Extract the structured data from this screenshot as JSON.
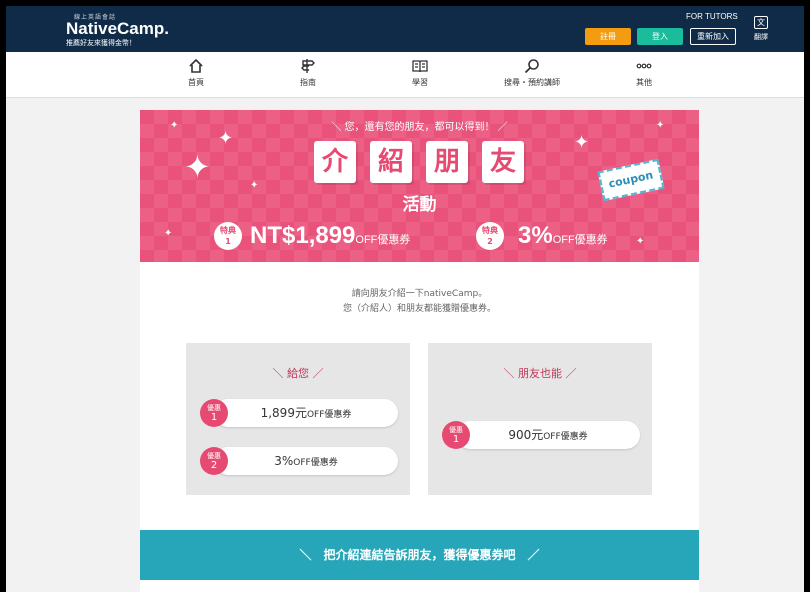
{
  "header": {
    "logo_small": "線上英語會話",
    "logo_brand": "NativeCamp.",
    "logo_tagline": "推薦好友來獲得金幣！",
    "for_tutors": "FOR TUTORS",
    "register_label": "註冊",
    "login_label": "登入",
    "rejoin_label": "重新加入",
    "translate_label": "翻譯"
  },
  "nav": {
    "items": [
      {
        "label": "首頁",
        "icon": "home-icon"
      },
      {
        "label": "指南",
        "icon": "signpost-icon"
      },
      {
        "label": "學習",
        "icon": "book-icon"
      },
      {
        "label": "搜尋・預約講師",
        "icon": "search-icon"
      },
      {
        "label": "其他",
        "icon": "more-icon"
      }
    ]
  },
  "hero": {
    "subtitle": "＼ 您，還有您的朋友，都可以得到！ ／",
    "title_chars": [
      "介",
      "紹",
      "朋",
      "友"
    ],
    "campaign": "活動",
    "perk1_badge": "特典",
    "perk1_num": "1",
    "perk1_value": "NT$1,899",
    "perk1_suffix": "OFF優惠券",
    "perk2_badge": "特典",
    "perk2_num": "2",
    "perk2_value": "3%",
    "perk2_suffix": "OFF優惠券",
    "coupon_label": "coupon"
  },
  "intro": {
    "line1": "請向朋友介紹一下nativeCamp。",
    "line2": "您（介紹人）和朋友都能獲贈優惠券。"
  },
  "panels": {
    "you": {
      "title": "＼ 給您 ／",
      "items": [
        {
          "badge": "優惠",
          "num": "1",
          "value": "1,899元",
          "suffix": "OFF優惠券"
        },
        {
          "badge": "優惠",
          "num": "2",
          "value": "3%",
          "suffix": "OFF優惠券"
        }
      ]
    },
    "friend": {
      "title": "＼ 朋友也能 ／",
      "items": [
        {
          "badge": "優惠",
          "num": "1",
          "value": "900元",
          "suffix": "OFF優惠券"
        }
      ]
    }
  },
  "cta": {
    "label": "＼　把介紹連結告訴朋友，獲得優惠券吧　／"
  },
  "colors": {
    "header_bg": "#0f2b47",
    "accent_pink": "#e64a72",
    "register_orange": "#f39c12",
    "login_green": "#1abc9c",
    "cta_teal": "#26a6b8"
  }
}
